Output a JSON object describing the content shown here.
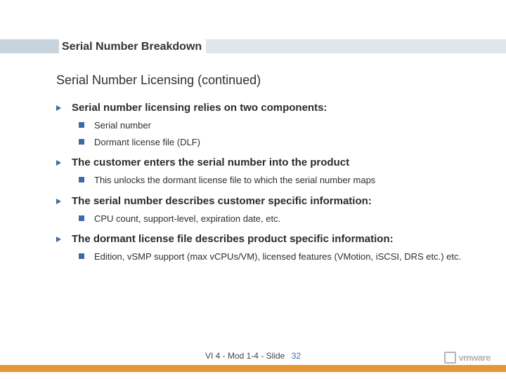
{
  "title": "Serial Number Breakdown",
  "section_title": "Serial Number Licensing (continued)",
  "bullets": {
    "b0": {
      "text": "Serial number licensing relies on two components:",
      "sub": [
        "Serial number",
        "Dormant license file (DLF)"
      ]
    },
    "b1": {
      "text": "The customer enters the serial number into the product",
      "sub": [
        "This unlocks the dormant license file to which the serial number maps"
      ]
    },
    "b2": {
      "text": "The serial number describes customer specific information:",
      "sub": [
        "CPU count, support-level, expiration date, etc."
      ]
    },
    "b3": {
      "text": "The dormant license file describes product specific information:",
      "sub": [
        "Edition, vSMP support (max vCPUs/VM), licensed features (VMotion, iSCSI, DRS etc.) etc."
      ]
    }
  },
  "footer": {
    "label": "VI 4 - Mod 1-4 - Slide",
    "number": "32"
  },
  "logo_text": "vmware"
}
